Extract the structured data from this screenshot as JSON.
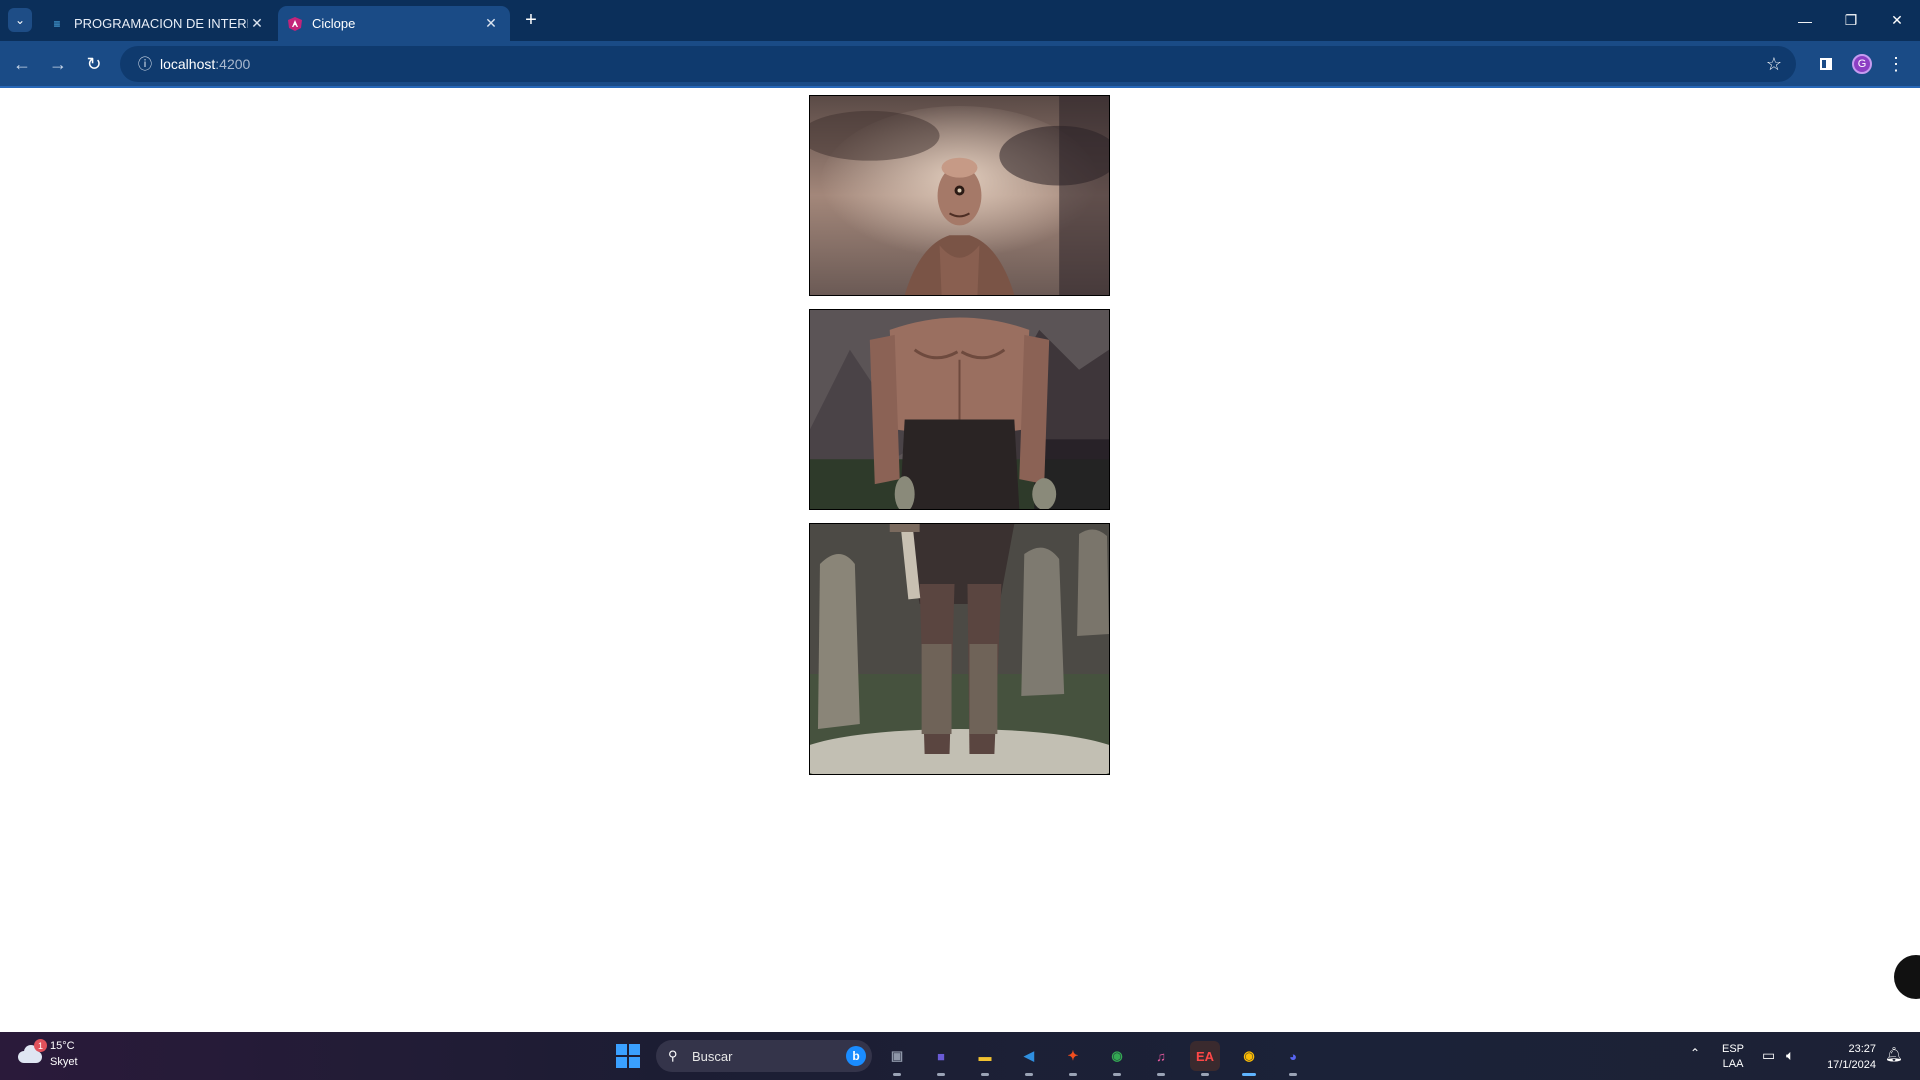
{
  "browser": {
    "tabs": [
      {
        "title": "PROGRAMACION DE INTERFAS",
        "icon": "document-icon",
        "active": false
      },
      {
        "title": "Ciclope",
        "icon": "angular-icon",
        "active": true
      }
    ],
    "new_tab_icon": "plus-icon",
    "address": {
      "host": "localhost",
      "port": ":4200"
    },
    "profile_initial": "G",
    "colors": {
      "frame": "#0b2f5a",
      "toolbar": "#1a4b86",
      "omnibox": "#0f3a6e"
    }
  },
  "page": {
    "images": [
      {
        "name": "cyclops-head",
        "description_icon": "cyclops-image-1"
      },
      {
        "name": "cyclops-torso",
        "description_icon": "cyclops-image-2"
      },
      {
        "name": "cyclops-legs",
        "description_icon": "cyclops-image-3"
      }
    ]
  },
  "taskbar": {
    "weather": {
      "temp": "15°C",
      "condition": "Skyet",
      "badge": "1"
    },
    "search_placeholder": "Buscar",
    "apps": [
      {
        "name": "task-view",
        "glyph": "▣",
        "color": "#8e96a8"
      },
      {
        "name": "video-call",
        "glyph": "■",
        "color": "#6a5bd6"
      },
      {
        "name": "file-explorer",
        "glyph": "▬",
        "color": "#f2c230"
      },
      {
        "name": "vscode",
        "glyph": "◀",
        "color": "#2f8fe0"
      },
      {
        "name": "figma",
        "glyph": "✦",
        "color": "#f24e1e"
      },
      {
        "name": "chrome-profile-m",
        "glyph": "◉",
        "color": "#34a853"
      },
      {
        "name": "itunes",
        "glyph": "♫",
        "color": "#e85aa0"
      },
      {
        "name": "ea",
        "glyph": "EA",
        "color": "#ff4747"
      },
      {
        "name": "chrome-profile-g",
        "glyph": "◉",
        "color": "#fbbc05"
      },
      {
        "name": "discord",
        "glyph": "◕",
        "color": "#5865f2"
      }
    ],
    "language": {
      "line1": "ESP",
      "line2": "LAA"
    },
    "clock": {
      "time": "23:27",
      "date": "17/1/2024"
    }
  }
}
